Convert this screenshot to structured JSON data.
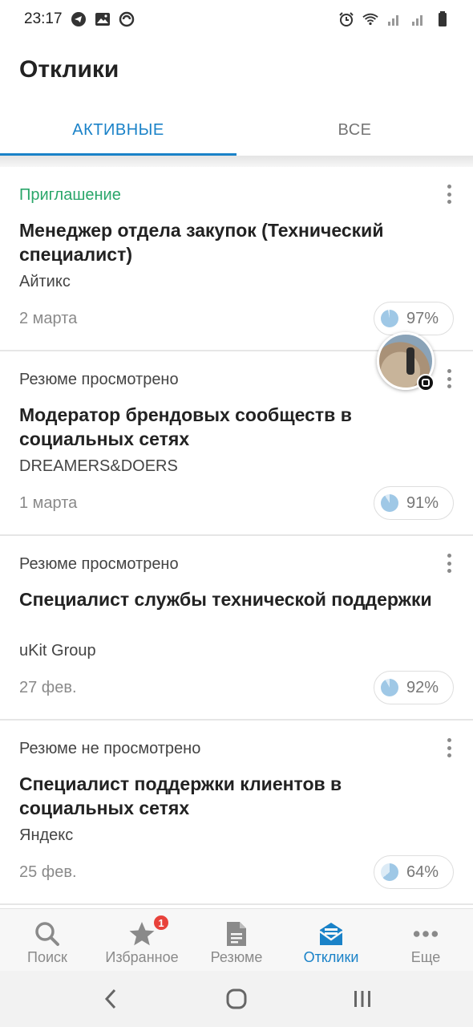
{
  "status_bar": {
    "time": "23:17",
    "left_icons": [
      "telegram-icon",
      "image-icon",
      "sync-icon"
    ],
    "right_icons": [
      "alarm-icon",
      "wifi-icon",
      "signal-icon",
      "signal-icon",
      "battery-icon"
    ]
  },
  "header": {
    "title": "Отклики"
  },
  "tabs": [
    {
      "label": "АКТИВНЫЕ",
      "active": true
    },
    {
      "label": "ВСЕ",
      "active": false
    }
  ],
  "responses": [
    {
      "status": "Приглашение",
      "status_type": "invite",
      "title": "Менеджер отдела закупок (Технический специалист)",
      "company": "Айтикс",
      "date": "2 марта",
      "match_label": "97%",
      "match": 97
    },
    {
      "status": "Резюме просмотрено",
      "status_type": "viewed",
      "title": "Модератор брендовых сообществ в социальных сетях",
      "company": "DREAMERS&DOERS",
      "date": "1 марта",
      "match_label": "91%",
      "match": 91
    },
    {
      "status": "Резюме просмотрено",
      "status_type": "viewed",
      "title": "Специалист службы технической поддержки",
      "company": "uKit Group",
      "date": "27 фев.",
      "match_label": "92%",
      "match": 92
    },
    {
      "status": "Резюме не просмотрено",
      "status_type": "not-viewed",
      "title": "Специалист поддержки клиентов в социальных сетях",
      "company": "Яндекс",
      "date": "25 фев.",
      "match_label": "64%",
      "match": 64
    }
  ],
  "bottom_nav": {
    "items": [
      {
        "label": "Поиск",
        "icon": "search-icon"
      },
      {
        "label": "Избранное",
        "icon": "star-icon",
        "badge": "1"
      },
      {
        "label": "Резюме",
        "icon": "document-icon"
      },
      {
        "label": "Отклики",
        "icon": "inbox-icon",
        "active": true
      },
      {
        "label": "Еще",
        "icon": "more-icon"
      }
    ]
  },
  "colors": {
    "accent": "#1a82c8",
    "invite": "#2aa66a",
    "badge": "#e8423b",
    "pie_fill": "#9fc8e6",
    "pie_rest": "#dcebf6"
  }
}
